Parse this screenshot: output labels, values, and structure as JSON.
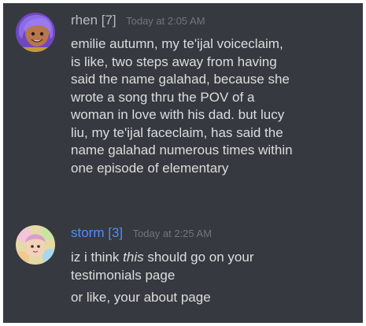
{
  "messages": [
    {
      "username": "rhen [7]",
      "username_color": "#b9bbbe",
      "timestamp": "Today at 2:05 AM",
      "avatar_icon": "purple-haired-character-avatar",
      "lines": [
        "emilie autumn, my te'ijal voiceclaim,",
        "is like, two steps away from having",
        "said the name galahad, because she",
        "wrote a song thru the POV of a",
        "woman in love with his dad. but lucy",
        "liu, my te'ijal faceclaim, has said the",
        "name galahad numerous times within",
        "one episode of elementary"
      ]
    },
    {
      "username": "storm [3]",
      "username_color": "#4f8ff7",
      "timestamp": "Today at 2:25 AM",
      "avatar_icon": "pastel-character-avatar",
      "line1_before": "iz i think ",
      "line1_emphasis": "this",
      "line1_after": " should go on your",
      "line2": "testimonials page",
      "followup": "or like, your about page"
    }
  ]
}
